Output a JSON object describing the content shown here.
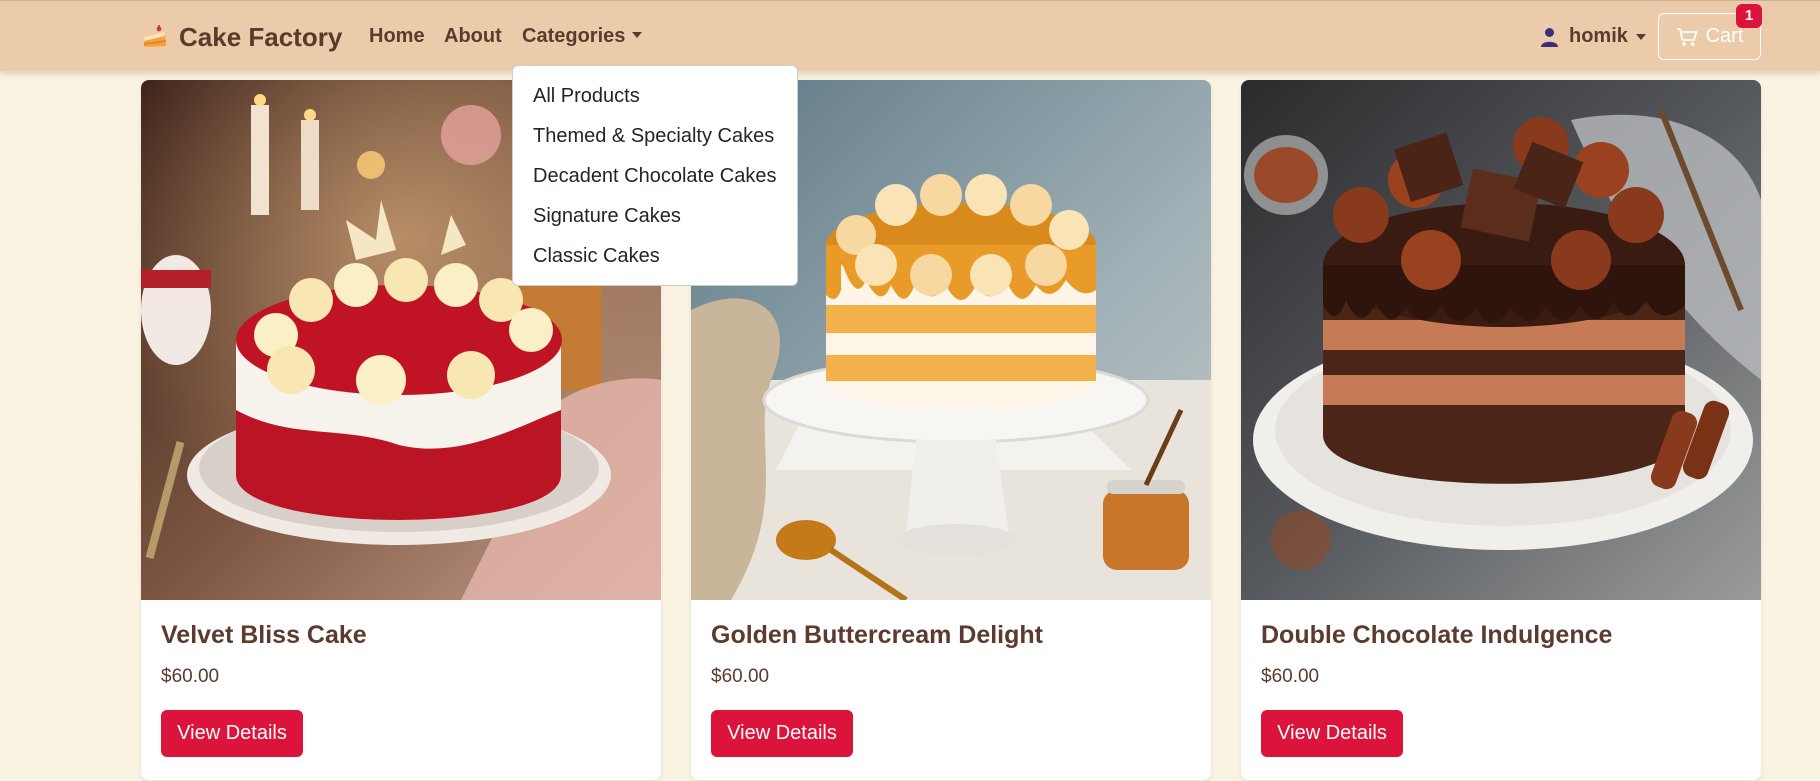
{
  "brand": {
    "name": "Cake Factory",
    "icon": "cake-icon"
  },
  "nav": {
    "home": "Home",
    "about": "About",
    "categories": "Categories"
  },
  "categories_menu": [
    "All Products",
    "Themed & Specialty Cakes",
    "Decadent Chocolate Cakes",
    "Signature Cakes",
    "Classic Cakes"
  ],
  "user": {
    "name": "homik",
    "icon": "user-icon"
  },
  "cart": {
    "label": "Cart",
    "count": "1",
    "icon": "cart-icon"
  },
  "products": [
    {
      "title": "Velvet Bliss Cake",
      "price": "$60.00",
      "button": "View Details"
    },
    {
      "title": "Golden Buttercream Delight",
      "price": "$60.00",
      "button": "View Details"
    },
    {
      "title": "Double Chocolate Indulgence",
      "price": "$60.00",
      "button": "View Details"
    }
  ],
  "colors": {
    "navbar": "#ebcba9",
    "page_background": "#fbf3e2",
    "accent": "#dc143c",
    "text_brown": "#5c3a2e"
  }
}
